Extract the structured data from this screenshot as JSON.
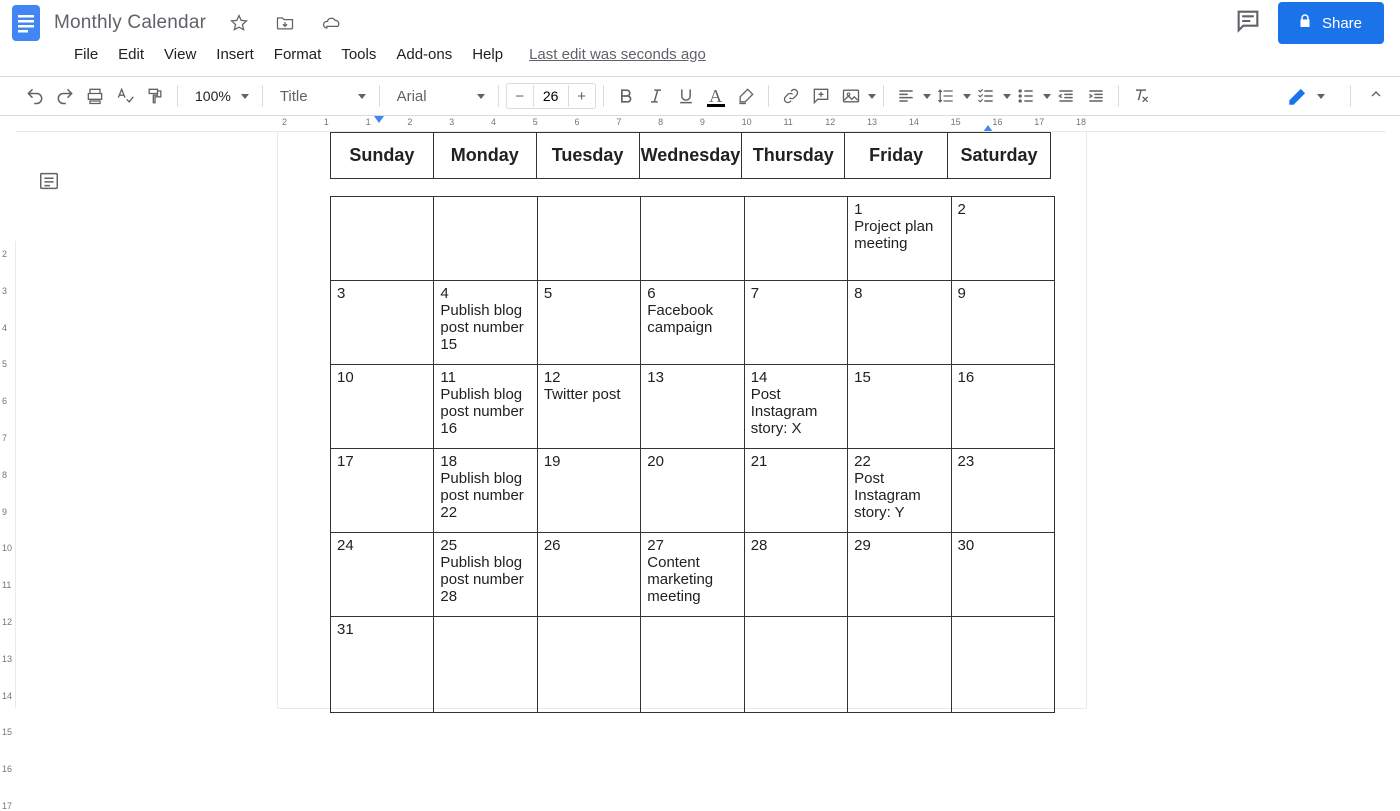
{
  "doc": {
    "title": "Monthly Calendar",
    "last_edit": "Last edit was seconds ago"
  },
  "menus": [
    "File",
    "Edit",
    "View",
    "Insert",
    "Format",
    "Tools",
    "Add-ons",
    "Help"
  ],
  "toolbar": {
    "zoom": "100%",
    "paragraph_style": "Title",
    "font": "Arial",
    "font_size": "26"
  },
  "share_label": "Share",
  "ruler_h": [
    "2",
    "1",
    "1",
    "2",
    "3",
    "4",
    "5",
    "6",
    "7",
    "8",
    "9",
    "10",
    "11",
    "12",
    "13",
    "14",
    "15",
    "16",
    "17",
    "18"
  ],
  "ruler_v": [
    "2",
    "3",
    "4",
    "5",
    "6",
    "7",
    "8",
    "9",
    "10",
    "11",
    "12",
    "13",
    "14",
    "15",
    "16",
    "17"
  ],
  "calendar": {
    "days": [
      "Sunday",
      "Monday",
      "Tuesday",
      "Wednesday",
      "Thursday",
      "Friday",
      "Saturday"
    ],
    "weeks": [
      [
        {
          "n": "",
          "e": ""
        },
        {
          "n": "",
          "e": ""
        },
        {
          "n": "",
          "e": ""
        },
        {
          "n": "",
          "e": ""
        },
        {
          "n": "",
          "e": ""
        },
        {
          "n": "1",
          "e": "Project plan meeting"
        },
        {
          "n": "2",
          "e": ""
        }
      ],
      [
        {
          "n": "3",
          "e": ""
        },
        {
          "n": "4",
          "e": "Publish blog post number 15"
        },
        {
          "n": "5",
          "e": ""
        },
        {
          "n": "6",
          "e": "Facebook campaign"
        },
        {
          "n": "7",
          "e": ""
        },
        {
          "n": "8",
          "e": ""
        },
        {
          "n": "9",
          "e": ""
        }
      ],
      [
        {
          "n": "10",
          "e": ""
        },
        {
          "n": "11",
          "e": "Publish blog post number 16"
        },
        {
          "n": "12",
          "e": "Twitter post"
        },
        {
          "n": "13",
          "e": ""
        },
        {
          "n": "14",
          "e": "Post Instagram story: X"
        },
        {
          "n": "15",
          "e": ""
        },
        {
          "n": "16",
          "e": ""
        }
      ],
      [
        {
          "n": "17",
          "e": ""
        },
        {
          "n": "18",
          "e": "Publish blog post number 22"
        },
        {
          "n": "19",
          "e": ""
        },
        {
          "n": "20",
          "e": ""
        },
        {
          "n": "21",
          "e": ""
        },
        {
          "n": "22",
          "e": "Post Instagram story: Y"
        },
        {
          "n": "23",
          "e": ""
        }
      ],
      [
        {
          "n": "24",
          "e": ""
        },
        {
          "n": "25",
          "e": "Publish blog post number 28"
        },
        {
          "n": "26",
          "e": ""
        },
        {
          "n": "27",
          "e": "Content marketing meeting"
        },
        {
          "n": "28",
          "e": ""
        },
        {
          "n": "29",
          "e": ""
        },
        {
          "n": "30",
          "e": ""
        }
      ],
      [
        {
          "n": "31",
          "e": ""
        },
        {
          "n": "",
          "e": ""
        },
        {
          "n": "",
          "e": ""
        },
        {
          "n": "",
          "e": ""
        },
        {
          "n": "",
          "e": ""
        },
        {
          "n": "",
          "e": ""
        },
        {
          "n": "",
          "e": ""
        }
      ]
    ]
  }
}
